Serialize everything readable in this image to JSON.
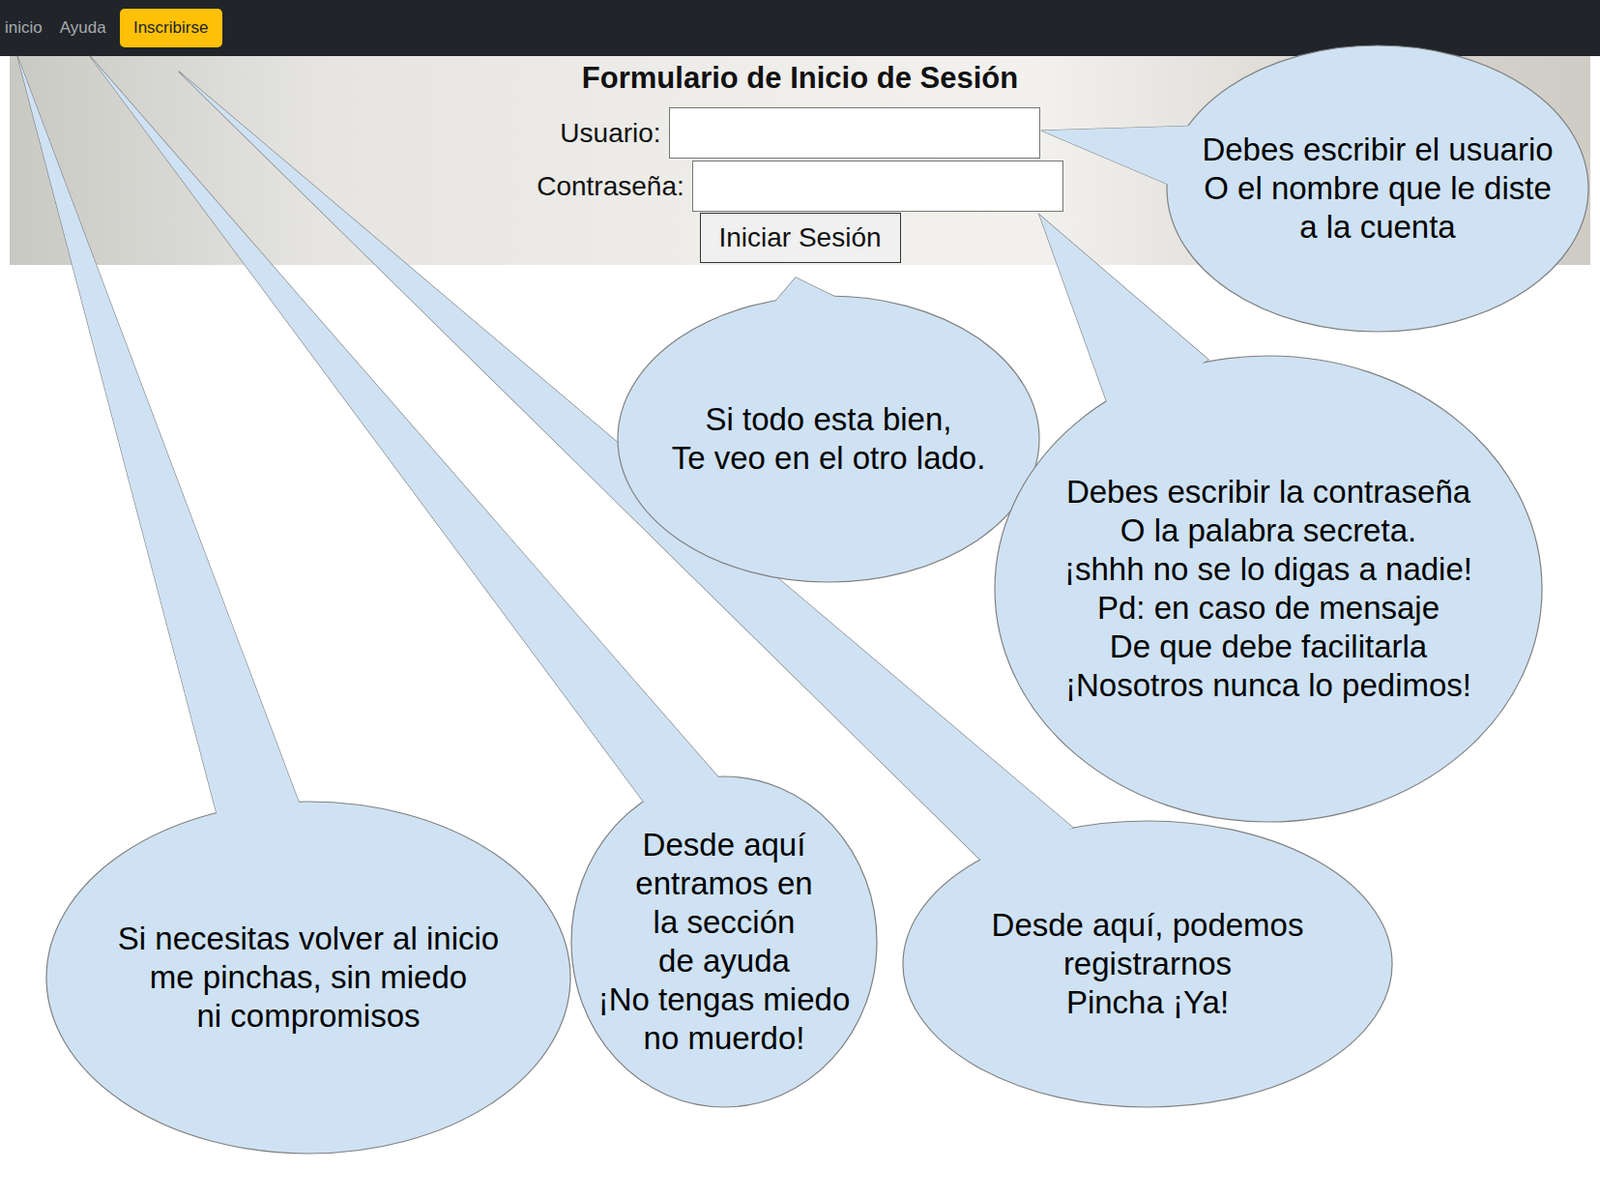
{
  "nav": {
    "items": [
      {
        "label": "inicio",
        "kind": "link"
      },
      {
        "label": "Ayuda",
        "kind": "link"
      },
      {
        "label": "Inscribirse",
        "kind": "button"
      }
    ]
  },
  "form": {
    "title": "Formulario de Inicio de Sesión",
    "fields": [
      {
        "label": "Usuario:",
        "value": ""
      },
      {
        "label": "Contraseña:",
        "value": ""
      }
    ],
    "submit": "Iniciar Sesión"
  },
  "callouts": [
    {
      "lines": [
        "Si necesitas volver al inicio",
        "me pinchas, sin miedo",
        "ni compromisos"
      ]
    },
    {
      "lines": [
        "Desde aquí",
        "entramos en",
        "la sección",
        "de ayuda",
        "¡No tengas miedo",
        "no muerdo!"
      ]
    },
    {
      "lines": [
        "Desde aquí, podemos",
        "registrarnos",
        "Pincha ¡Ya!"
      ]
    },
    {
      "lines": [
        "Si todo esta bien,",
        "Te veo en el otro lado."
      ]
    },
    {
      "lines": [
        "Debes escribir el usuario",
        "O el nombre que le diste",
        "a la cuenta"
      ]
    },
    {
      "lines": [
        "Debes escribir la contraseña",
        "O la palabra secreta.",
        "¡shhh no se lo digas a nadie!",
        "Pd: en caso de mensaje",
        "De que debe facilitarla",
        "¡Nosotros nunca lo pedimos!"
      ]
    }
  ]
}
